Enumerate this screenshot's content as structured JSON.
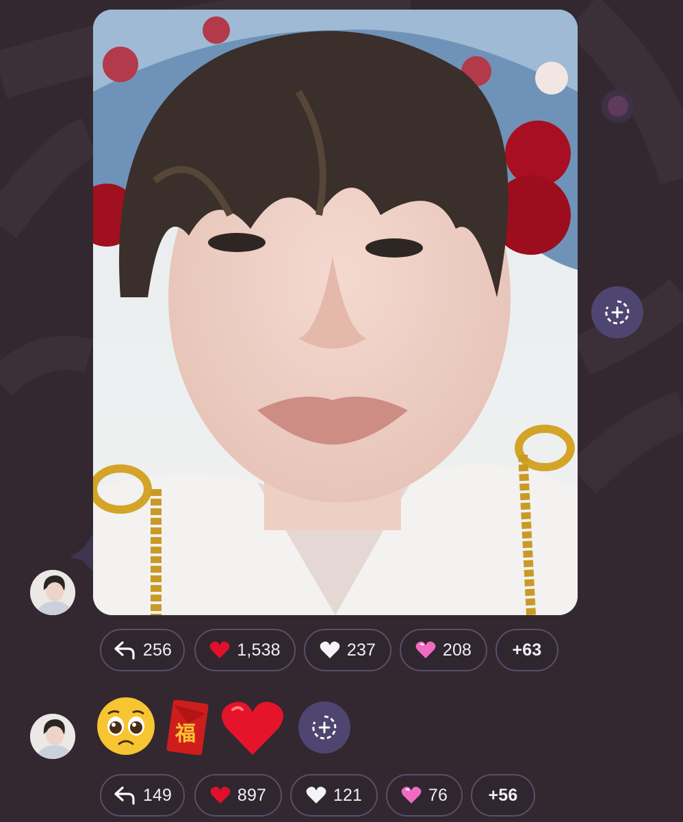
{
  "theme": {
    "background": "#332830",
    "pill_border": "#5a4f6a",
    "add_button": "#4e4670",
    "heart_red": "#e0102a",
    "heart_pink": "#f06bc0"
  },
  "post1": {
    "photo_alt": "selfie-photo",
    "add_reaction_icon": "add-reaction-icon",
    "reactions": [
      {
        "icon": "reply-icon",
        "count": "256"
      },
      {
        "icon": "red-heart-icon",
        "count": "1,538"
      },
      {
        "icon": "white-heart-icon",
        "count": "237"
      },
      {
        "icon": "pink-heart-icon",
        "count": "208"
      },
      {
        "icon": "",
        "count": "+63"
      }
    ]
  },
  "post2": {
    "emojis": [
      "pleading-face-emoji",
      "red-envelope-fu-emoji",
      "red-heart-emoji"
    ],
    "envelope_text": "福",
    "add_reaction_icon": "add-reaction-icon",
    "reactions": [
      {
        "icon": "reply-icon",
        "count": "149"
      },
      {
        "icon": "red-heart-icon",
        "count": "897"
      },
      {
        "icon": "white-heart-icon",
        "count": "121"
      },
      {
        "icon": "pink-heart-icon",
        "count": "76"
      },
      {
        "icon": "",
        "count": "+56"
      }
    ]
  }
}
